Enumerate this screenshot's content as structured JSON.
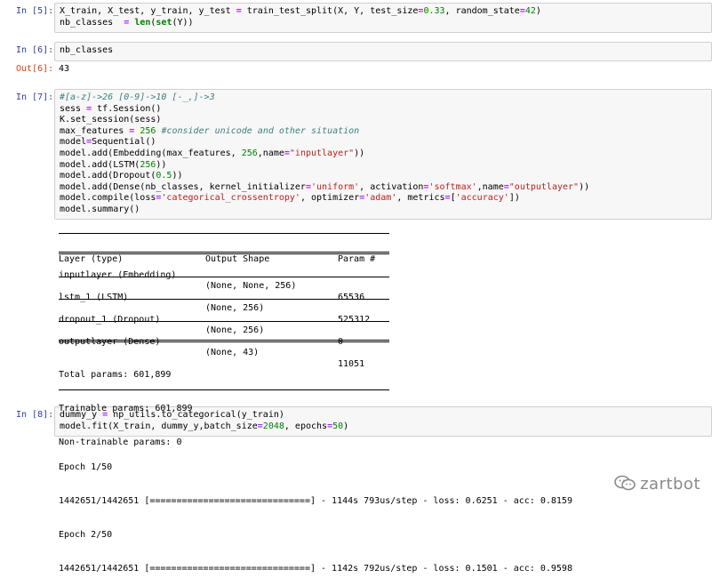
{
  "cells": [
    {
      "prompt": "In [5]:",
      "lines": [
        [
          [
            "X_train, X_test, y_train, y_test ",
            ""
          ],
          [
            "=",
            "op"
          ],
          [
            " train_test_split(X, Y, test_size",
            ""
          ],
          [
            "=",
            "op"
          ],
          [
            "0.33",
            "num"
          ],
          [
            ", random_state",
            ""
          ],
          [
            "=",
            "op"
          ],
          [
            "42",
            "num"
          ],
          [
            ")",
            ""
          ]
        ],
        [
          [
            "nb_classes  ",
            ""
          ],
          [
            "=",
            "op"
          ],
          [
            " ",
            ""
          ],
          [
            "len",
            "kw"
          ],
          [
            "(",
            ""
          ],
          [
            "set",
            "kw"
          ],
          [
            "(Y))",
            ""
          ]
        ]
      ]
    },
    {
      "prompt": "In [6]:",
      "lines": [
        [
          [
            "nb_classes",
            ""
          ]
        ]
      ]
    },
    {
      "prompt": "In [7]:",
      "lines": [
        [
          [
            "#[a-z]->26 [0-9]->10 [-_,]->3",
            "cm"
          ]
        ],
        [
          [
            "sess ",
            ""
          ],
          [
            "=",
            "op"
          ],
          [
            " tf.Session()",
            ""
          ]
        ],
        [
          [
            "K.set_session(sess)",
            ""
          ]
        ],
        [
          [
            "max_features ",
            ""
          ],
          [
            "=",
            "op"
          ],
          [
            " ",
            ""
          ],
          [
            "256",
            "num"
          ],
          [
            " ",
            ""
          ],
          [
            "#consider unicode and other situation",
            "cm"
          ]
        ],
        [
          [
            "model",
            ""
          ],
          [
            "=",
            "op"
          ],
          [
            "Sequential()",
            ""
          ]
        ],
        [
          [
            "model.add(Embedding(max_features, ",
            ""
          ],
          [
            "256",
            "num"
          ],
          [
            ",name",
            ""
          ],
          [
            "=",
            "op"
          ],
          [
            "\"inputlayer\"",
            "str"
          ],
          [
            "))",
            ""
          ]
        ],
        [
          [
            "model.add(LSTM(",
            ""
          ],
          [
            "256",
            "num"
          ],
          [
            "))",
            ""
          ]
        ],
        [
          [
            "model.add(Dropout(",
            ""
          ],
          [
            "0.5",
            "num"
          ],
          [
            "))",
            ""
          ]
        ],
        [
          [
            "model.add(Dense(nb_classes, kernel_initializer",
            ""
          ],
          [
            "=",
            "op"
          ],
          [
            "'uniform'",
            "str"
          ],
          [
            ", activation",
            ""
          ],
          [
            "=",
            "op"
          ],
          [
            "'softmax'",
            "str"
          ],
          [
            ",name",
            ""
          ],
          [
            "=",
            "op"
          ],
          [
            "\"outputlayer\"",
            "str"
          ],
          [
            "))",
            ""
          ]
        ],
        [
          [
            "model.compile(loss",
            ""
          ],
          [
            "=",
            "op"
          ],
          [
            "'categorical_crossentropy'",
            "str"
          ],
          [
            ", optimizer",
            ""
          ],
          [
            "=",
            "op"
          ],
          [
            "'adam'",
            "str"
          ],
          [
            ", metrics",
            ""
          ],
          [
            "=",
            "op"
          ],
          [
            "[",
            ""
          ],
          [
            "'accuracy'",
            "str"
          ],
          [
            "])",
            ""
          ]
        ],
        [
          [
            "model.summary()",
            ""
          ]
        ]
      ]
    },
    {
      "prompt": "In [8]:",
      "lines": [
        [
          [
            "dummy_y ",
            ""
          ],
          [
            "=",
            "op"
          ],
          [
            " np_utils.to_categorical(y_train)",
            ""
          ]
        ],
        [
          [
            "model.fit(X_train, dummy_y,batch_size",
            ""
          ],
          [
            "=",
            "op"
          ],
          [
            "2048",
            "num"
          ],
          [
            ", epochs",
            ""
          ],
          [
            "=",
            "op"
          ],
          [
            "50",
            "num"
          ],
          [
            ")",
            ""
          ]
        ]
      ]
    }
  ],
  "out6": {
    "prompt": "Out[6]:",
    "value": "43"
  },
  "summary": {
    "headers": [
      "Layer (type)",
      "Output Shape",
      "Param #"
    ],
    "rows": [
      [
        "inputlayer (Embedding)",
        "(None, None, 256)",
        "65536"
      ],
      [
        "lstm_1 (LSTM)",
        "(None, 256)",
        "525312"
      ],
      [
        "dropout_1 (Dropout)",
        "(None, 256)",
        "0"
      ],
      [
        "outputlayer (Dense)",
        "(None, 43)",
        "11051"
      ]
    ],
    "totals": [
      "Total params: 601,899",
      "Trainable params: 601,899",
      "Non-trainable params: 0"
    ]
  },
  "training_log": [
    "Epoch 1/50",
    "1442651/1442651 [==============================] - 1144s 793us/step - loss: 0.6251 - acc: 0.8159",
    "Epoch 2/50",
    "1442651/1442651 [==============================] - 1142s 792us/step - loss: 0.1501 - acc: 0.9598"
  ],
  "watermark": "zartbot"
}
